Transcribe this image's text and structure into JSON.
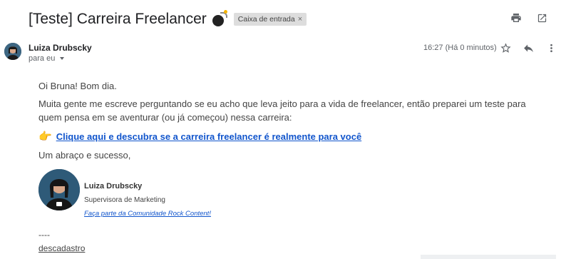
{
  "subject": "[Teste] Carreira Freelancer",
  "label": {
    "text": "Caixa de entrada",
    "remove": "×"
  },
  "sender": {
    "name": "Luiza Drubscky",
    "to": "para eu"
  },
  "time": "16:27 (Há 0 minutos)",
  "icons": {
    "print": "print-icon",
    "open_new": "open-in-new-icon",
    "star": "star-icon",
    "reply": "reply-icon",
    "more": "more-vert-icon",
    "bomb": "bomb-emoji-icon",
    "hand": "backhand-pointing-right-icon",
    "dropdown": "chevron-down-icon"
  },
  "body": {
    "greeting": "Oi Bruna! Bom dia.",
    "paragraph": "Muita gente me escreve perguntando se eu acho que leva jeito para a vida de freelancer, então preparei um teste para quem pensa em se aventurar (ou já começou) nessa carreira:",
    "cta_emoji": "👉",
    "cta_link": "Clique aqui e descubra se a carreira freelancer é realmente para você",
    "regards": "Um abraço e sucesso,"
  },
  "signature": {
    "name": "Luiza Drubscky",
    "role": "Supervisora de Marketing",
    "link": "Faça parte da Comunidade Rock Content!"
  },
  "footer": {
    "dashes": "----",
    "unsubscribe": "descadastro",
    "period": "."
  },
  "colors": {
    "link": "#1155cc",
    "label_bg": "#dddddd",
    "hand": "#f4b400"
  }
}
